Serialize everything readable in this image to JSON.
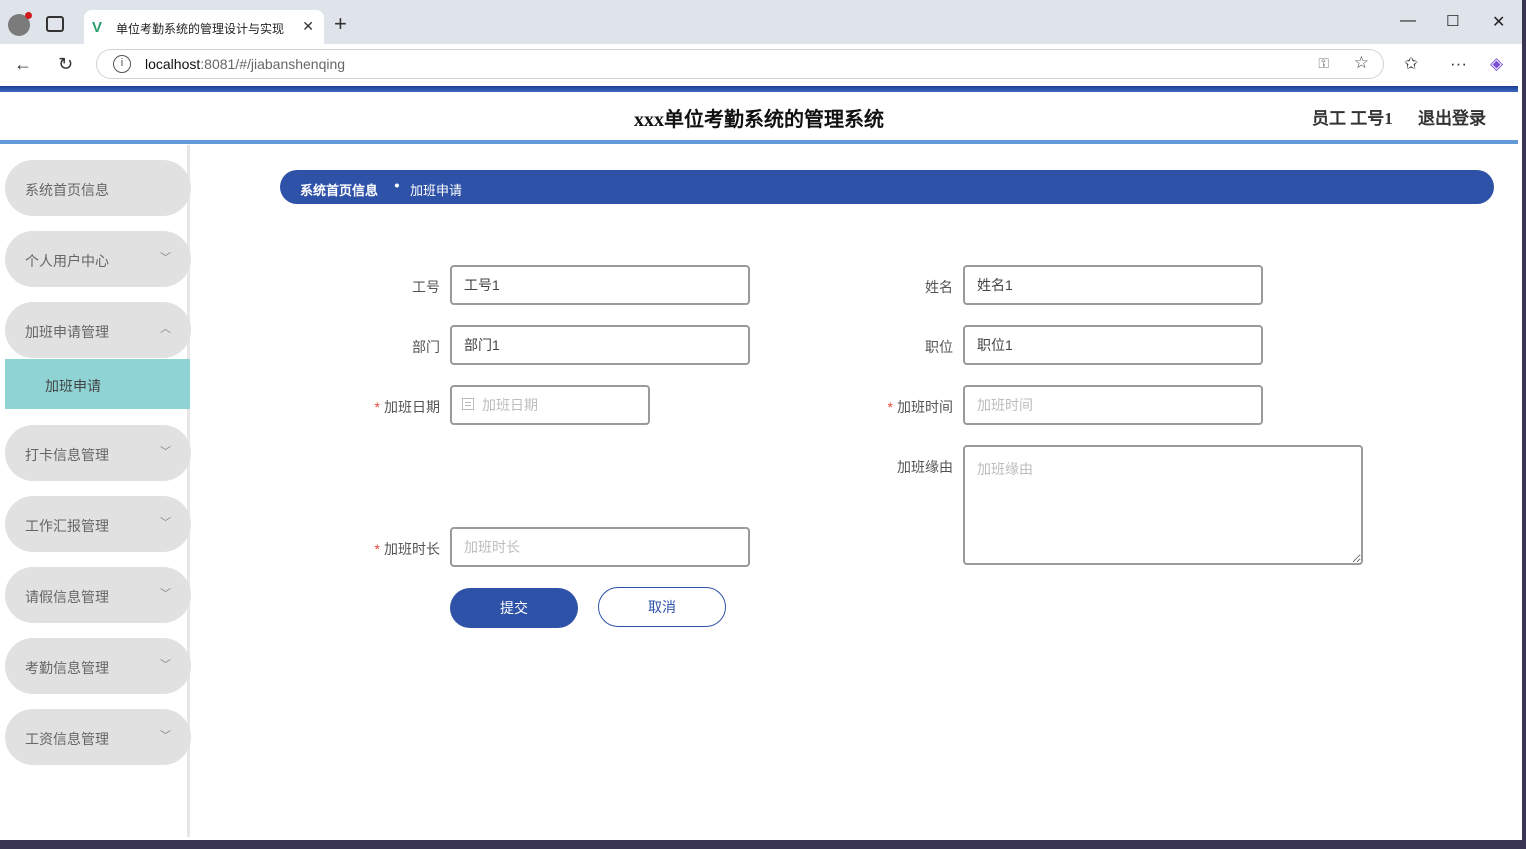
{
  "browser": {
    "tab_title": "单位考勤系统的管理设计与实现",
    "tab_favicon": "V",
    "url_host": "localhost",
    "url_path": ":8081/#/jiabanshenqing"
  },
  "header": {
    "title": "xxx单位考勤系统的管理系统",
    "user_label": "员工 工号1",
    "logout_label": "退出登录"
  },
  "sidebar": {
    "items": [
      {
        "label": "系统首页信息",
        "expandable": false
      },
      {
        "label": "个人用户中心",
        "expandable": true,
        "expanded": false
      },
      {
        "label": "加班申请管理",
        "expandable": true,
        "expanded": true
      },
      {
        "label": "打卡信息管理",
        "expandable": true,
        "expanded": false
      },
      {
        "label": "工作汇报管理",
        "expandable": true,
        "expanded": false
      },
      {
        "label": "请假信息管理",
        "expandable": true,
        "expanded": false
      },
      {
        "label": "考勤信息管理",
        "expandable": true,
        "expanded": false
      },
      {
        "label": "工资信息管理",
        "expandable": true,
        "expanded": false
      }
    ],
    "active_subitem": "加班申请"
  },
  "breadcrumb": {
    "home": "系统首页信息",
    "separator": "ꔷ",
    "current": "加班申请"
  },
  "form": {
    "gonghao": {
      "label": "工号",
      "value": "工号1"
    },
    "xingming": {
      "label": "姓名",
      "value": "姓名1"
    },
    "bumen": {
      "label": "部门",
      "value": "部门1"
    },
    "zhiwei": {
      "label": "职位",
      "value": "职位1"
    },
    "jiaban_riqi": {
      "label": "加班日期",
      "placeholder": "加班日期",
      "required": true
    },
    "jiaban_shijian": {
      "label": "加班时间",
      "placeholder": "加班时间",
      "required": true
    },
    "jiaban_yuanyou": {
      "label": "加班缘由",
      "placeholder": "加班缘由"
    },
    "jiaban_shichang": {
      "label": "加班时长",
      "placeholder": "加班时长",
      "required": true
    },
    "required_mark": "*",
    "submit_label": "提交",
    "cancel_label": "取消"
  },
  "colors": {
    "primary": "#2e52a8",
    "submenu_active": "#8fd3d4",
    "menu_bg": "#e1e1e1",
    "required": "#e74c3c"
  }
}
